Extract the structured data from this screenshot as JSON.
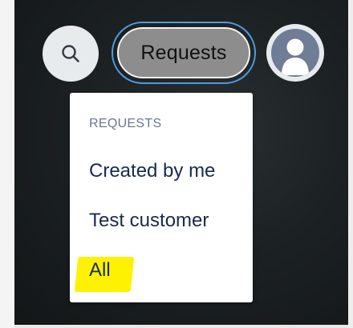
{
  "header": {
    "search_icon": "search-icon",
    "requests_label": "Requests",
    "avatar_icon": "user-avatar-icon"
  },
  "dropdown": {
    "section_title": "REQUESTS",
    "items": [
      {
        "label": "Created by me"
      },
      {
        "label": "Test customer"
      },
      {
        "label": "All",
        "highlighted": true
      }
    ]
  },
  "colors": {
    "focus_ring": "#4e9be0",
    "highlight": "#fff200",
    "avatar": "#6f7e96",
    "pill_fill": "#8d8d8d"
  }
}
